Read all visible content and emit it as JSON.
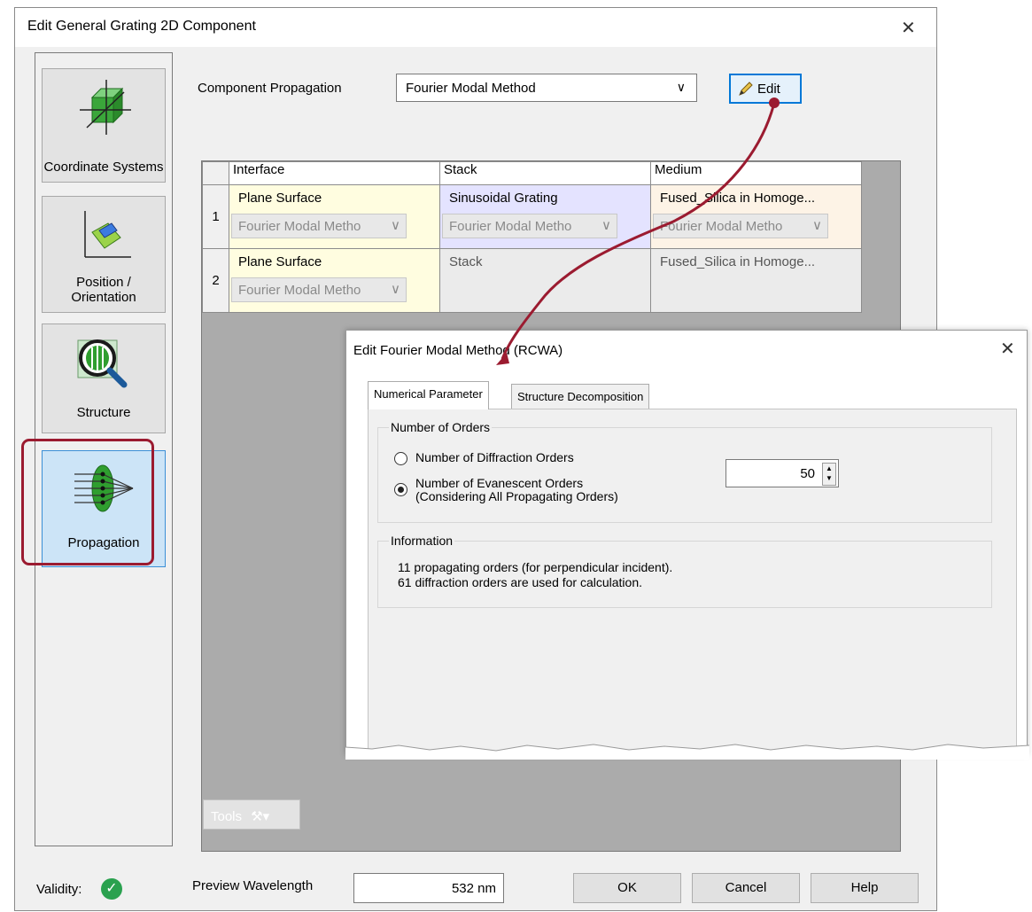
{
  "main_dialog": {
    "title": "Edit General Grating 2D Component",
    "close_glyph": "✕"
  },
  "nav": {
    "items": [
      {
        "label": "Coordinate Systems",
        "icon": "coordinate-systems-icon"
      },
      {
        "label": "Position / Orientation",
        "icon": "position-orientation-icon"
      },
      {
        "label": "Structure",
        "icon": "structure-icon"
      },
      {
        "label": "Propagation",
        "icon": "propagation-icon",
        "selected": true
      }
    ]
  },
  "component_propagation": {
    "label": "Component Propagation",
    "selected": "Fourier Modal Method",
    "edit_label": "Edit"
  },
  "grid": {
    "headers": [
      "Interface",
      "Stack",
      "Medium"
    ],
    "rows": [
      {
        "num": "1",
        "interface": {
          "text": "Plane Surface",
          "method": "Fourier Modal Metho"
        },
        "stack": {
          "text": "Sinusoidal Grating",
          "method": "Fourier Modal Metho"
        },
        "medium": {
          "text": "Fused_Silica in Homoge...",
          "method": "Fourier Modal Metho"
        }
      },
      {
        "num": "2",
        "interface": {
          "text": "Plane Surface",
          "method": "Fourier Modal Metho"
        },
        "stack": {
          "text": "Stack"
        },
        "medium": {
          "text": "Fused_Silica in Homoge..."
        }
      }
    ]
  },
  "tools": {
    "label": "Tools"
  },
  "footer": {
    "validity_label": "Validity:",
    "wavelength_label": "Preview Wavelength",
    "wavelength_value": "532 nm",
    "ok": "OK",
    "cancel": "Cancel",
    "help": "Help"
  },
  "popup": {
    "title": "Edit Fourier Modal Method (RCWA)",
    "tabs": [
      "Numerical Parameter",
      "Structure Decomposition"
    ],
    "orders_group": "Number of Orders",
    "option_diffraction": "Number of Diffraction Orders",
    "option_evanescent_1": "Number of Evanescent Orders",
    "option_evanescent_2": "(Considering All Propagating Orders)",
    "selected_option": "evanescent",
    "orders_value": "50",
    "info_group": "Information",
    "info_line1": "11 propagating orders (for perpendicular incident).",
    "info_line2": "61 diffraction orders are used for calculation."
  },
  "colors": {
    "highlight": "#9b1b30",
    "arrow": "#9b1b30",
    "interface_cell": "#fffde0",
    "stack_cell": "#e4e3ff",
    "medium_cell": "#fdf3e6",
    "selected_nav": "#cce4f7",
    "validity_ok": "#2aa14f"
  }
}
